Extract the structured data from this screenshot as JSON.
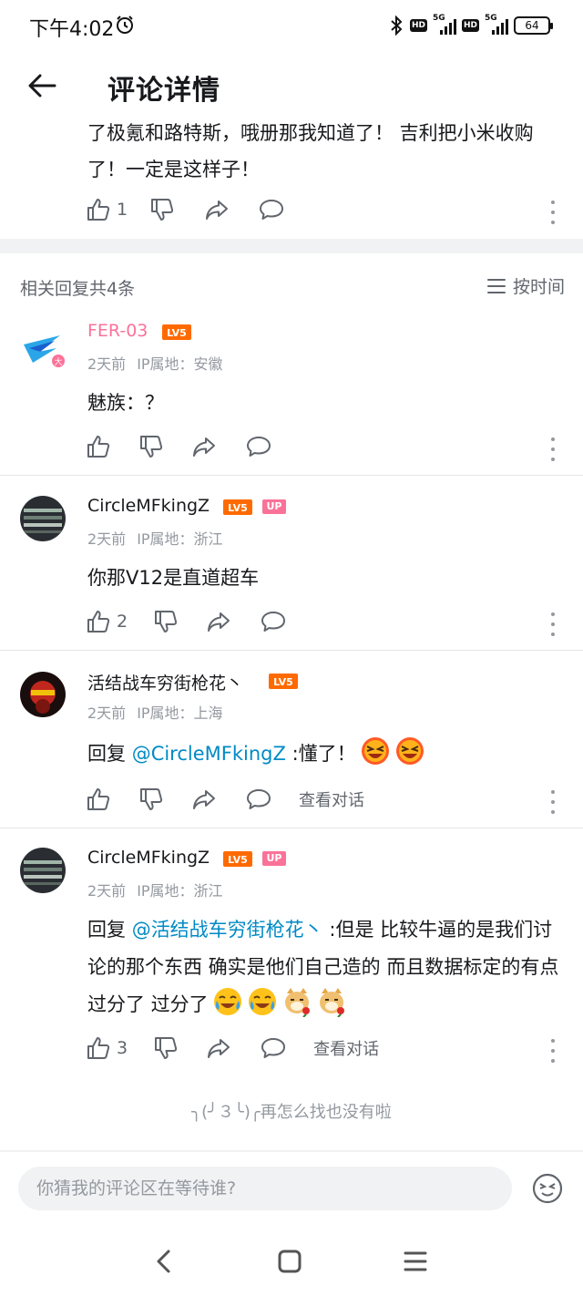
{
  "status_bar": {
    "time": "下午4:02",
    "network_1": "5G",
    "network_2": "5G",
    "hd": "HD",
    "battery": "64"
  },
  "header": {
    "title": "评论详情"
  },
  "main_comment": {
    "text": "了极氪和路特斯，哦册那我知道了！ 吉利把小米收购了！一定是这样子！",
    "likes": "1"
  },
  "reply_section": {
    "count_label": "相关回复共4条",
    "sort_label": "按时间"
  },
  "replies": [
    {
      "username": "FER-03",
      "level": "LV5",
      "time": "2天前",
      "ip": "IP属地：安徽",
      "content": "魅族：？",
      "likes": ""
    },
    {
      "username": "CircleMFkingZ",
      "level": "LV5",
      "up_badge": "UP",
      "time": "2天前",
      "ip": "IP属地：浙江",
      "content": "你那V12是直道超车",
      "likes": "2"
    },
    {
      "username": "活结战车穷街枪花丶",
      "level": "LV5",
      "time": "2天前",
      "ip": "IP属地：上海",
      "reply_prefix": "回复 ",
      "mention": "@CircleMFkingZ",
      "content": " :懂了！",
      "emojis": [
        "laughing-emoji",
        "laughing-emoji"
      ],
      "likes": "",
      "view_conversation": "查看对话"
    },
    {
      "username": "CircleMFkingZ",
      "level": "LV5",
      "up_badge": "UP",
      "time": "2天前",
      "ip": "IP属地：浙江",
      "reply_prefix": "回复 ",
      "mention": "@活结战车穷街枪花丶",
      "content": " :但是 比较牛逼的是我们讨论的那个东西 确实是他们自己造的 而且数据标定的有点过分了 过分了",
      "emojis": [
        "crying-laughing-emoji",
        "crying-laughing-emoji",
        "doge-rose-emoji",
        "doge-rose-emoji"
      ],
      "likes": "3",
      "view_conversation": "查看对话"
    }
  ],
  "end_hint": "╮(╯３╰)╭再怎么找也没有啦",
  "input": {
    "placeholder": "你猜我的评论区在等待谁?"
  },
  "colors": {
    "accent_pink": "#fb7299",
    "mention_blue": "#008ac5",
    "level_orange": "#ff6a00",
    "gray_text": "#9499a0"
  }
}
